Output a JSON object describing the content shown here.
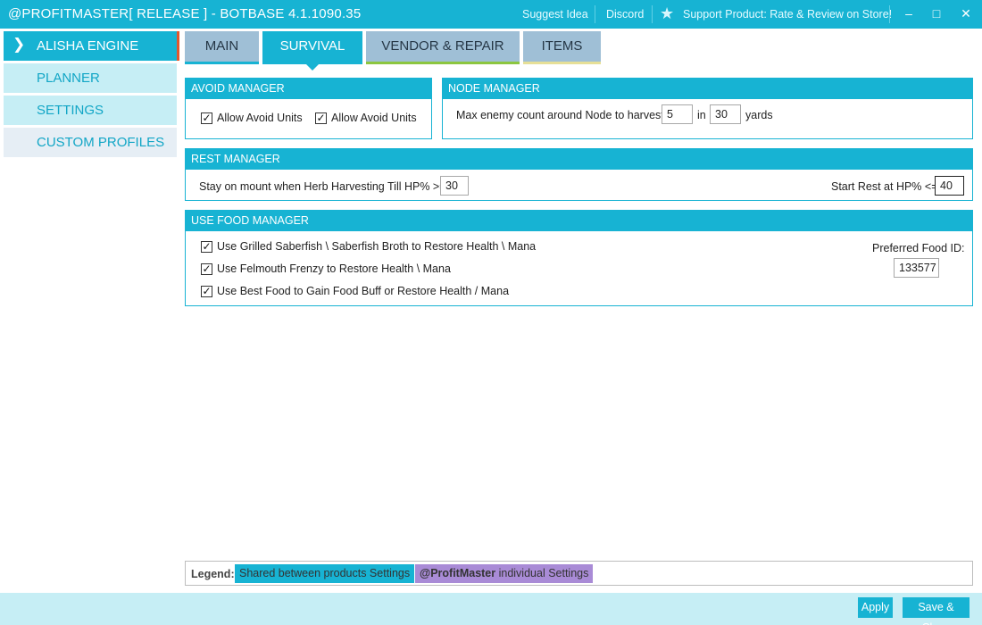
{
  "window": {
    "title": "@PROFITMASTER[ RELEASE ] - BOTBASE 4.1.1090.35",
    "links": {
      "suggest": "Suggest Idea",
      "discord": "Discord",
      "support": "Support Product: Rate & Review on Store!"
    },
    "controls": {
      "minimize": "–",
      "maximize": "□",
      "close": "✕"
    }
  },
  "sidebar": {
    "items": [
      {
        "label": "ALISHA ENGINE",
        "active": true,
        "icon": "chevron-right-icon"
      },
      {
        "label": "PLANNER"
      },
      {
        "label": "SETTINGS"
      },
      {
        "label": "CUSTOM PROFILES"
      }
    ]
  },
  "tabs": [
    {
      "label": "MAIN",
      "underline": "#17b3d3"
    },
    {
      "label": "SURVIVAL",
      "active": true
    },
    {
      "label": "VENDOR & REPAIR",
      "underline": "#8cc63f"
    },
    {
      "label": "ITEMS",
      "underline": "#e6df97"
    }
  ],
  "avoid_manager": {
    "title": "AVOID MANAGER",
    "options": [
      {
        "label": "Allow Avoid Units",
        "checked": true
      },
      {
        "label": "Allow Avoid Units",
        "checked": true
      }
    ]
  },
  "node_manager": {
    "title": "NODE MANAGER",
    "label": "Max enemy count around Node to harvest",
    "count": "5",
    "in_label": "in",
    "yards": "30",
    "yards_label": "yards"
  },
  "rest_manager": {
    "title": "REST MANAGER",
    "mount_label": "Stay on mount when Herb Harvesting Till HP% >=",
    "mount_value": "30",
    "rest_label": "Start Rest at HP% <=",
    "rest_value": "40"
  },
  "food_manager": {
    "title": "USE FOOD MANAGER",
    "options": [
      {
        "label": "Use Grilled Saberfish \\ Saberfish Broth to Restore Health \\ Mana",
        "checked": true
      },
      {
        "label": "Use Felmouth Frenzy to Restore Health \\ Mana",
        "checked": true
      },
      {
        "label": "Use Best Food to Gain Food Buff or Restore Health / Mana",
        "checked": true
      }
    ],
    "preferred_label": "Preferred Food ID:",
    "preferred_value": "133577"
  },
  "legend": {
    "label": "Legend:",
    "shared": "Shared between products Settings",
    "shared_color": "#17b3d3",
    "individual_bold": "@ProfitMaster",
    "individual_rest": " individual Settings",
    "individual_color": "#a98bd6"
  },
  "footer": {
    "apply": "Apply",
    "save_close": "Save & Close"
  },
  "colors": {
    "accent": "#17b3d3",
    "sidebar_bg": "#c6eef5",
    "active_marker": "#e2572e"
  }
}
